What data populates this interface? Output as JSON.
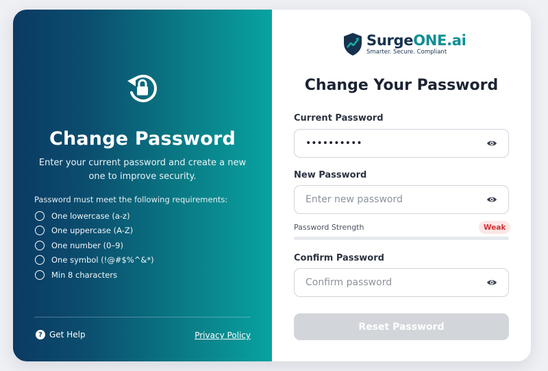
{
  "left_panel": {
    "title": "Change Password",
    "subtitle": "Enter your current password and create a new one to improve security.",
    "requirements_title": "Password must meet the following requirements:",
    "requirements": [
      "One lowercase (a-z)",
      "One uppercase (A-Z)",
      "One number (0–9)",
      "One symbol (!@#$%^&*)",
      "Min 8 characters"
    ],
    "help_label": "Get Help",
    "privacy_label": "Privacy Policy",
    "icon": "lock-rotate-icon"
  },
  "brand": {
    "name_prefix": "Surge",
    "name_suffix": "ONE.ai",
    "tagline": "Smarter. Secure. Compliant"
  },
  "form": {
    "heading": "Change Your Password",
    "current_password": {
      "label": "Current Password",
      "value": "••••••••••",
      "placeholder": ""
    },
    "new_password": {
      "label": "New Password",
      "value": "",
      "placeholder": "Enter new password"
    },
    "strength": {
      "label": "Password Strength",
      "level": "Weak",
      "fraction": 0
    },
    "confirm_password": {
      "label": "Confirm Password",
      "value": "",
      "placeholder": "Confirm password"
    },
    "submit_label": "Reset Password"
  },
  "colors": {
    "gradient_start": "#0b3a63",
    "gradient_end": "#08a3a0",
    "brand_accent": "#0f8f93",
    "weak": "#d03232",
    "button_disabled": "#d2d5da"
  }
}
